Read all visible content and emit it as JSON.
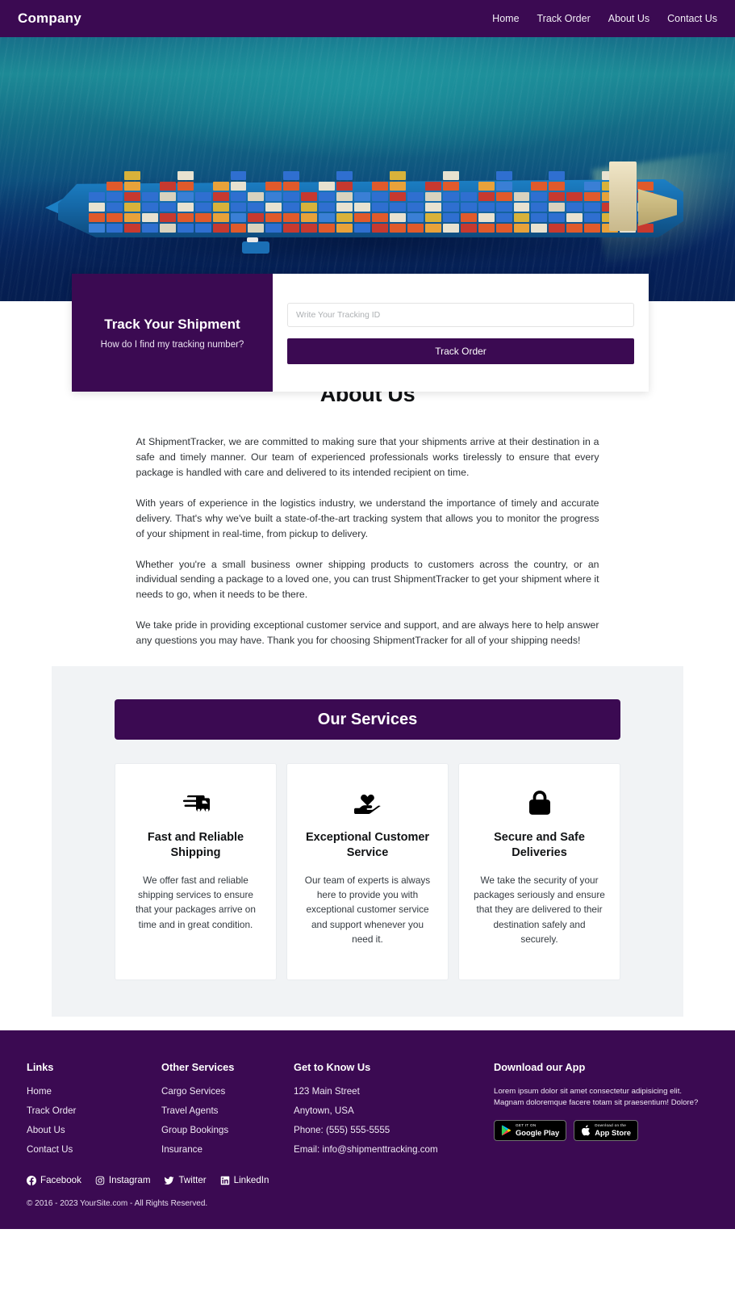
{
  "navbar": {
    "brand": "Company",
    "links": [
      {
        "label": "Home"
      },
      {
        "label": "Track Order"
      },
      {
        "label": "About Us"
      },
      {
        "label": "Contact Us"
      }
    ]
  },
  "hero": {
    "image_alt": "aerial-view-of-container-cargo-ship-at-sea"
  },
  "track": {
    "title": "Track Your Shipment",
    "subtitle": "How do I find my tracking number?",
    "input_placeholder": "Write Your Tracking ID",
    "input_value": "",
    "button_label": "Track Order"
  },
  "about": {
    "title": "About Us",
    "paragraphs": [
      "At ShipmentTracker, we are committed to making sure that your shipments arrive at their destination in a safe and timely manner. Our team of experienced professionals works tirelessly to ensure that every package is handled with care and delivered to its intended recipient on time.",
      "With years of experience in the logistics industry, we understand the importance of timely and accurate delivery. That's why we've built a state-of-the-art tracking system that allows you to monitor the progress of your shipment in real-time, from pickup to delivery.",
      "Whether you're a small business owner shipping products to customers across the country, or an individual sending a package to a loved one, you can trust ShipmentTracker to get your shipment where it needs to go, when it needs to be there.",
      "We take pride in providing exceptional customer service and support, and are always here to help answer any questions you may have. Thank you for choosing ShipmentTracker for all of your shipping needs!"
    ]
  },
  "services": {
    "banner_title": "Our Services",
    "cards": [
      {
        "icon": "shipping-truck-icon",
        "title": "Fast and Reliable Shipping",
        "text": "We offer fast and reliable shipping services to ensure that your packages arrive on time and in great condition."
      },
      {
        "icon": "hand-holding-heart-icon",
        "title": "Exceptional Customer Service",
        "text": "Our team of experts is always here to provide you with exceptional customer service and support whenever you need it."
      },
      {
        "icon": "lock-icon",
        "title": "Secure and Safe Deliveries",
        "text": "We take the security of your packages seriously and ensure that they are delivered to their destination safely and securely."
      }
    ]
  },
  "footer": {
    "links": {
      "heading": "Links",
      "items": [
        {
          "label": "Home"
        },
        {
          "label": "Track Order"
        },
        {
          "label": "About Us"
        },
        {
          "label": "Contact Us"
        }
      ]
    },
    "other_services": {
      "heading": "Other Services",
      "items": [
        {
          "label": "Cargo Services"
        },
        {
          "label": "Travel Agents"
        },
        {
          "label": "Group Bookings"
        },
        {
          "label": "Insurance"
        }
      ]
    },
    "get_to_know": {
      "heading": "Get to Know Us",
      "address_line1": "123 Main Street",
      "address_line2": "Anytown, USA",
      "phone": "Phone: (555) 555-5555",
      "email": "Email: info@shipmenttracking.com"
    },
    "app": {
      "heading": "Download our App",
      "description": "Lorem ipsum dolor sit amet consectetur adipisicing elit. Magnam doloremque facere totam sit praesentium! Dolore?",
      "google_play": {
        "small": "GET IT ON",
        "big": "Google Play"
      },
      "app_store": {
        "small": "Download on the",
        "big": "App Store"
      }
    },
    "socials": [
      {
        "icon": "facebook-icon",
        "label": "Facebook"
      },
      {
        "icon": "instagram-icon",
        "label": "Instagram"
      },
      {
        "icon": "twitter-icon",
        "label": "Twitter"
      },
      {
        "icon": "linkedin-icon",
        "label": "LinkedIn"
      }
    ],
    "copyright": "© 2016 - 2023 YourSite.com - All Rights Reserved."
  },
  "colors": {
    "brand_purple": "#3b0a52",
    "services_bg": "#f1f3f5",
    "page_bg": "#ffffff"
  }
}
